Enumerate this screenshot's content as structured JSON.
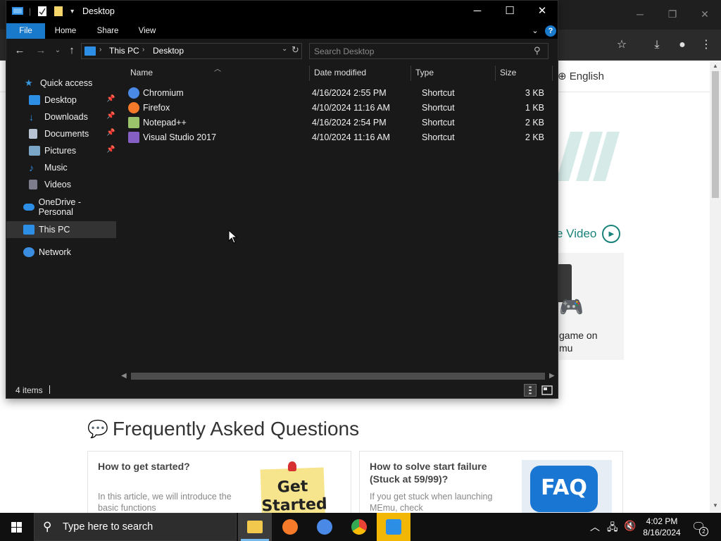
{
  "explorer": {
    "title": "Desktop",
    "ribbon_tabs": [
      "File",
      "Home",
      "Share",
      "View"
    ],
    "help_label": "?",
    "breadcrumb": [
      "This PC",
      "Desktop"
    ],
    "search_placeholder": "Search Desktop",
    "nav": {
      "quick_access": "Quick access",
      "items": [
        {
          "label": "Desktop",
          "icon": "desktop-folder-icon",
          "pinned": true
        },
        {
          "label": "Downloads",
          "icon": "downloads-folder-icon",
          "pinned": true
        },
        {
          "label": "Documents",
          "icon": "documents-folder-icon",
          "pinned": true
        },
        {
          "label": "Pictures",
          "icon": "pictures-folder-icon",
          "pinned": true
        },
        {
          "label": "Music",
          "icon": "music-folder-icon",
          "pinned": false
        },
        {
          "label": "Videos",
          "icon": "videos-folder-icon",
          "pinned": false
        }
      ],
      "onedrive": "OneDrive - Personal",
      "this_pc": "This PC",
      "network": "Network"
    },
    "columns": {
      "name": "Name",
      "date": "Date modified",
      "type": "Type",
      "size": "Size"
    },
    "files": [
      {
        "name": "Chromium",
        "date": "4/16/2024 2:55 PM",
        "type": "Shortcut",
        "size": "3 KB",
        "icon": "chromium-icon",
        "color": "#4a8ae6"
      },
      {
        "name": "Firefox",
        "date": "4/10/2024 11:16 AM",
        "type": "Shortcut",
        "size": "1 KB",
        "icon": "firefox-icon",
        "color": "#f57a2a"
      },
      {
        "name": "Notepad++",
        "date": "4/16/2024 2:54 PM",
        "type": "Shortcut",
        "size": "2 KB",
        "icon": "notepadpp-icon",
        "color": "#9bc36b"
      },
      {
        "name": "Visual Studio 2017",
        "date": "4/10/2024 11:16 AM",
        "type": "Shortcut",
        "size": "2 KB",
        "icon": "visual-studio-icon",
        "color": "#865fc5"
      }
    ],
    "status": "4 items"
  },
  "browser_page": {
    "language": "English",
    "video_link": "e Video",
    "promo_text": "game on\nmu",
    "faq_heading": "Frequently Asked Questions",
    "cards": [
      {
        "title": "How to get started?",
        "desc": "In this article, we will introduce the basic functions",
        "image_text": "Get Started"
      },
      {
        "title": "How to solve start failure (Stuck at 59/99)?",
        "desc": "If you get stuck when launching MEmu, check",
        "image_text": "FAQ"
      }
    ]
  },
  "taskbar": {
    "search_text": "Type here to search",
    "apps": [
      {
        "name": "file-explorer",
        "active": true
      },
      {
        "name": "firefox",
        "active": false
      },
      {
        "name": "chromium",
        "active": false
      },
      {
        "name": "chrome",
        "active": false
      },
      {
        "name": "memu",
        "active": false
      }
    ],
    "time": "4:02 PM",
    "date": "8/16/2024",
    "notifications": "2"
  }
}
